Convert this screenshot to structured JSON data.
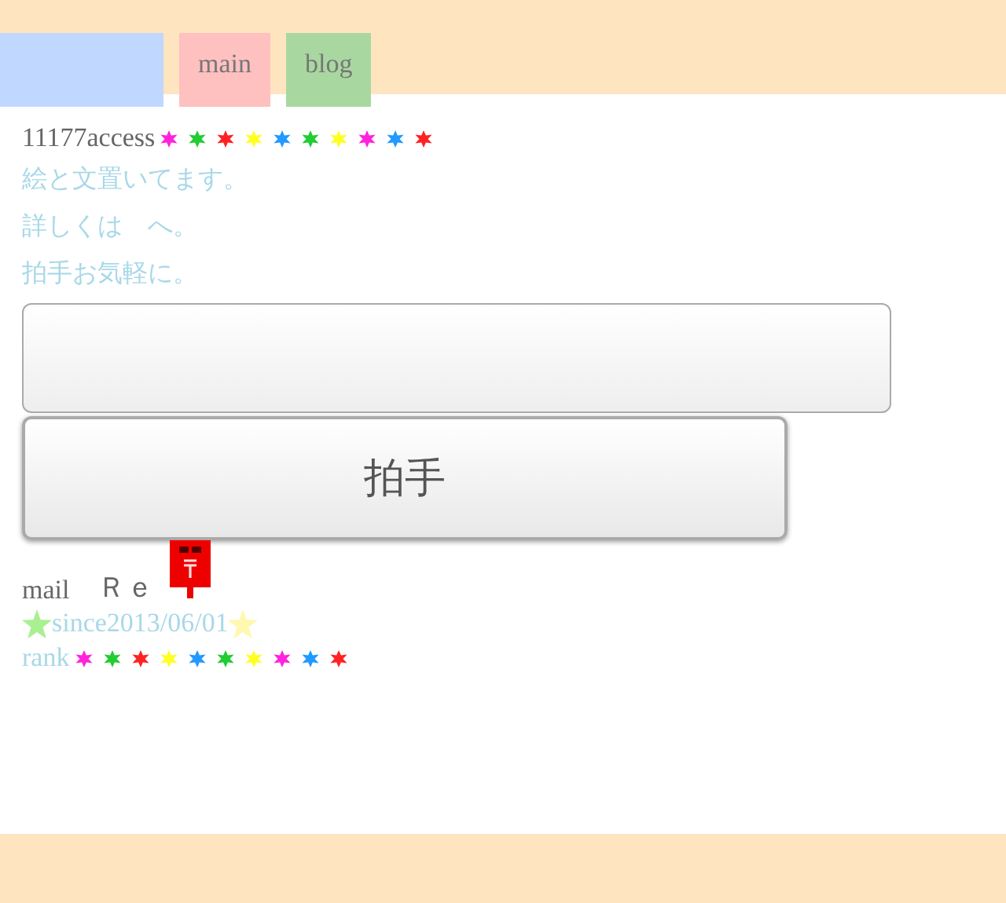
{
  "nav": [
    {
      "color": "#c0d8ff"
    },
    {
      "label": "main",
      "color": "#ffc0c0"
    },
    {
      "label": "blog",
      "color": "#a8d8a0"
    }
  ],
  "counter": {
    "count": "11177access",
    "sparkles": [
      {
        "color": "#ff22dd"
      },
      {
        "color": "#22cc33"
      },
      {
        "color": "#ff2222"
      },
      {
        "color": "#ffff22"
      },
      {
        "color": "#2299ff"
      },
      {
        "color": "#22cc33"
      },
      {
        "color": "#ffff22"
      },
      {
        "color": "#ff22dd"
      },
      {
        "color": "#2299ff"
      },
      {
        "color": "#ff2222"
      }
    ]
  },
  "intro": [
    "絵と文置いてます。",
    "詳しくは　へ。",
    "拍手お気軽に。"
  ],
  "clap_button": "拍手",
  "mail": {
    "label": "mail",
    "reply": "Ｒｅ"
  },
  "since": "since2013/06/01",
  "rank": {
    "label": "rank",
    "sparkles": [
      {
        "color": "#ff22dd"
      },
      {
        "color": "#22cc33"
      },
      {
        "color": "#ff2222"
      },
      {
        "color": "#ffff22"
      },
      {
        "color": "#2299ff"
      },
      {
        "color": "#22cc33"
      },
      {
        "color": "#ffff22"
      },
      {
        "color": "#ff22dd"
      },
      {
        "color": "#2299ff"
      },
      {
        "color": "#ff2222"
      }
    ]
  }
}
